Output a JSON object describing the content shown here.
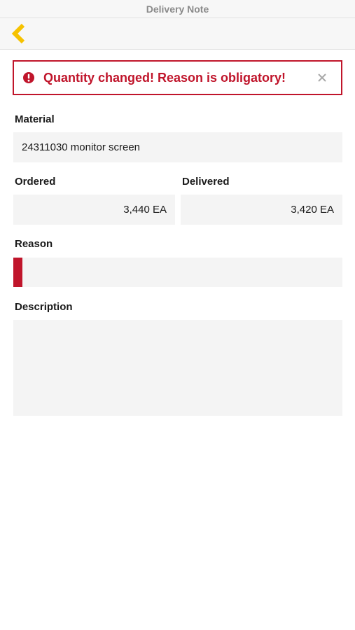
{
  "window": {
    "title": "Delivery Note"
  },
  "nav": {
    "back_icon": "chevron-left-icon",
    "accent_color": "#f6c200"
  },
  "alert": {
    "icon": "exclamation-circle-icon",
    "message": "Quantity changed! Reason is obligatory!",
    "close_icon": "close-icon",
    "color": "#c0152b"
  },
  "form": {
    "material": {
      "label": "Material",
      "value": "24311030 monitor screen"
    },
    "ordered": {
      "label": "Ordered",
      "value": "3,440 EA"
    },
    "delivered": {
      "label": "Delivered",
      "value": "3,420 EA"
    },
    "reason": {
      "label": "Reason",
      "value": ""
    },
    "description": {
      "label": "Description",
      "value": ""
    }
  }
}
